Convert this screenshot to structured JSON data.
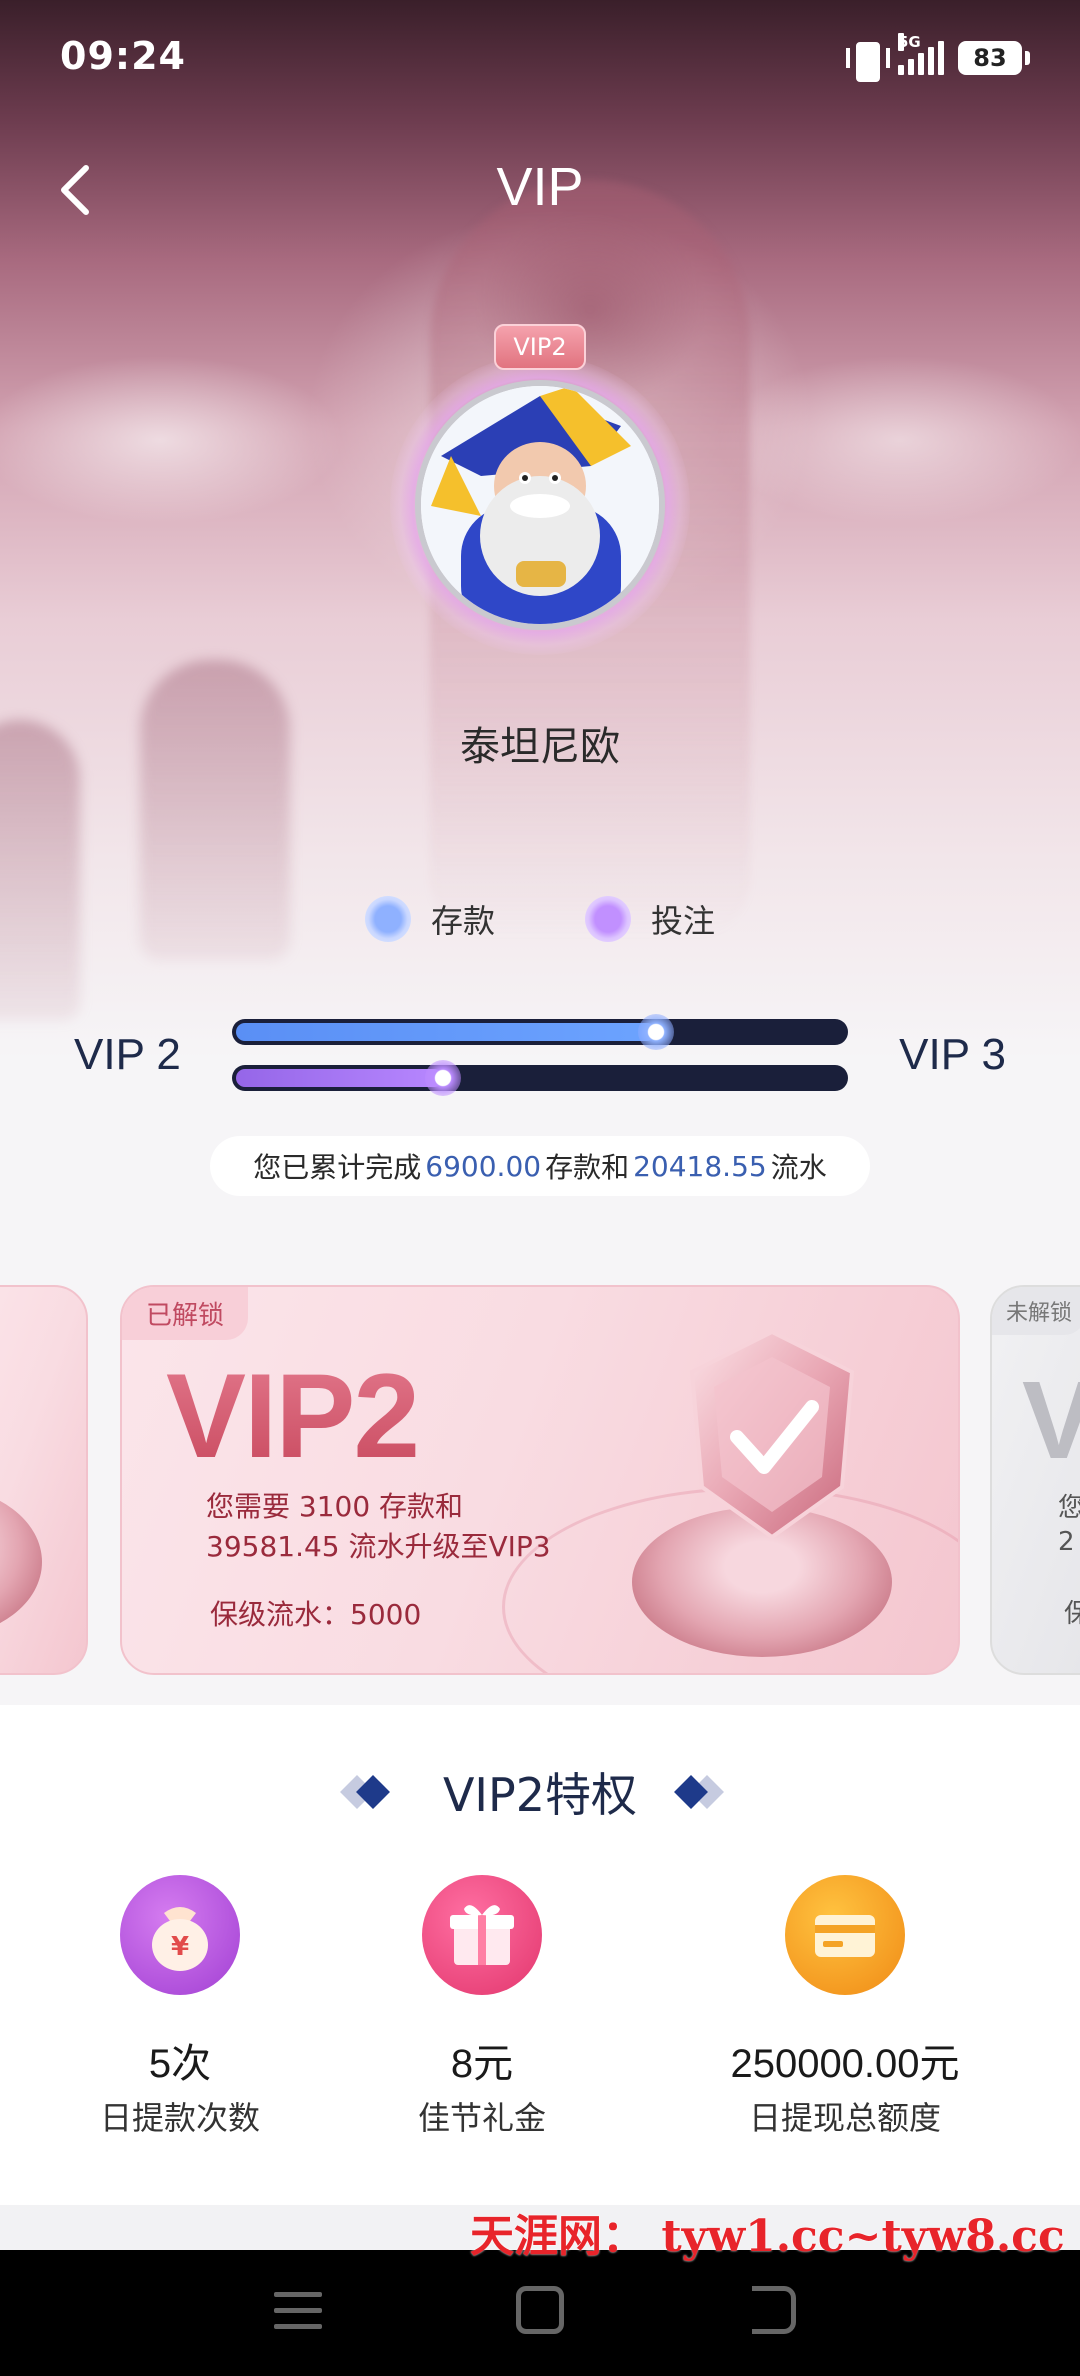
{
  "status_bar": {
    "time": "09:24",
    "network": "5G",
    "battery": "83"
  },
  "header": {
    "title": "VIP"
  },
  "profile": {
    "badge": "VIP2",
    "username": "泰坦尼欧"
  },
  "legend": {
    "deposit": "存款",
    "bet": "投注"
  },
  "progress": {
    "current_level": "VIP 2",
    "next_level": "VIP 3",
    "deposit_fraction": 0.69,
    "turnover_fraction": 0.34,
    "deposit_color": "#5a8ff5",
    "turnover_color": "#9566e8"
  },
  "summary": {
    "prefix": "您已累计完成",
    "deposit": "6900.00",
    "mid": "存款和",
    "turnover": "20418.55",
    "suffix": "流水"
  },
  "cards": {
    "main": {
      "tag": "已解锁",
      "level": "VIP2",
      "line1": "您需要 3100 存款和",
      "line2": "39581.45 流水升级至VIP3",
      "keep": "保级流水：5000"
    },
    "next": {
      "tag": "未解锁",
      "level_partial": "V",
      "line1_partial": "您",
      "line2_partial": "2",
      "keep_partial": "保"
    }
  },
  "privileges": {
    "title": "VIP2特权",
    "items": [
      {
        "value": "5次",
        "label": "日提款次数",
        "icon": "money-bag-icon"
      },
      {
        "value": "8元",
        "label": "佳节礼金",
        "icon": "gift-icon"
      },
      {
        "value": "250000.00元",
        "label": "日提现总额度",
        "icon": "card-icon"
      }
    ]
  },
  "watermark": "天涯网： tyw1.cc~tyw8.cc"
}
